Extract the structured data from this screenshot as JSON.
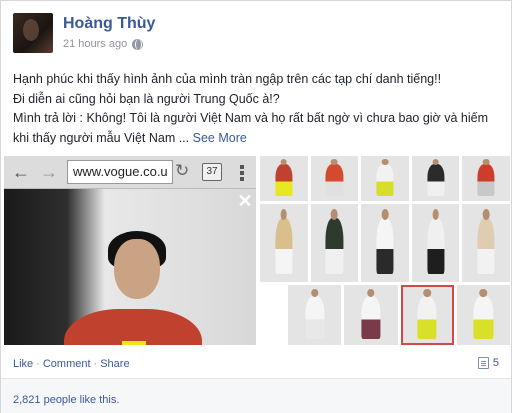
{
  "post": {
    "author": "Hoàng Thùy",
    "time": "21 hours ago",
    "privacy_icon": "globe-icon",
    "text_lines": [
      "Hạnh phúc khi thấy hình ảnh của mình tràn ngập trên các tạp chí danh tiếng!!",
      "Đi diễn ai cũng hỏi bạn là người Trung Quốc à!?",
      "Mình trả lời : Không! Tôi là người Việt Nam và họ rất bất ngờ vì chưa bao giờ và hiếm",
      "khi thấy người mẫu Việt Nam ..."
    ],
    "see_more": "See More"
  },
  "browser": {
    "url": "www.vogue.co.u",
    "tab_count": "37",
    "back_icon": "back-arrow-icon",
    "forward_icon": "forward-arrow-icon",
    "refresh_icon": "refresh-icon",
    "close_icon": "close-icon"
  },
  "thumbs": [
    {
      "coat": "#c0412e",
      "inner": "#e8e820"
    },
    {
      "coat": "#d44a2f",
      "inner": "#e0e0e0"
    },
    {
      "coat": "#f2f2f2",
      "inner": "#d6de2a"
    },
    {
      "coat": "#2b2b2b",
      "inner": "#f0f0f0"
    },
    {
      "coat": "#cc3d2a",
      "inner": "#c8c8c8"
    },
    {
      "coat": "#d8bf8c",
      "inner": "#f5f5f5"
    },
    {
      "coat": "#2e3a2e",
      "inner": "#f0f0f0"
    },
    {
      "coat": "#f5f5f5",
      "inner": "#2a2a2a"
    },
    {
      "coat": "#f0f0f0",
      "inner": "#1e1e1e"
    },
    {
      "coat": "#e0ccb0",
      "inner": "#f2f2f2"
    },
    {
      "coat": "#f5f5f5",
      "inner": "#e8e8e8"
    },
    {
      "coat": "#f5f5f5",
      "inner": "#7a3a4a"
    },
    {
      "coat": "#f2f2f2",
      "inner": "#d8e028"
    },
    {
      "coat": "#f5f5f5",
      "inner": "#d8e028"
    },
    {
      "coat": "#f5f5f5",
      "inner": "#f0f0f0"
    }
  ],
  "actions": {
    "like": "Like",
    "comment": "Comment",
    "share": "Share",
    "separator": "·",
    "share_count": "5"
  },
  "likes_text": "2,821 people like this."
}
